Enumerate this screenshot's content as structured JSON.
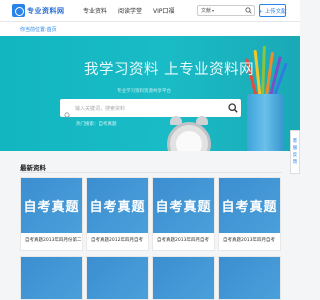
{
  "header": {
    "logo_text": "专业资料网",
    "nav": [
      "专业资料",
      "阅读学堂",
      "VIP口福"
    ],
    "search_select": "文献",
    "upload_label": "+ 上传文献"
  },
  "breadcrumb": "你当前位置:首页",
  "hero": {
    "title": "我学习资料 上专业资料网",
    "subtitle": "专业学习资料资源共享平台",
    "search_placeholder": "输入关键词，搜索资料",
    "hot_text": "热门搜索：自考真题"
  },
  "side_float": [
    "客",
    "服",
    "反",
    "馈"
  ],
  "latest": {
    "title": "最新资料",
    "cards": [
      {
        "thumb": "自考真题",
        "caption": "自考真题2013年四月份第二次"
      },
      {
        "thumb": "自考真题",
        "caption": "自考真题2012年四月自考"
      },
      {
        "thumb": "自考真题",
        "caption": "自考真题2013年四月自考"
      },
      {
        "thumb": "自考真题",
        "caption": "自考真题2013年四月自考"
      }
    ]
  },
  "colors": {
    "accent": "#2a84e8",
    "hero_bg": "#13b8c2",
    "card_thumb": "#3c8ed0"
  }
}
